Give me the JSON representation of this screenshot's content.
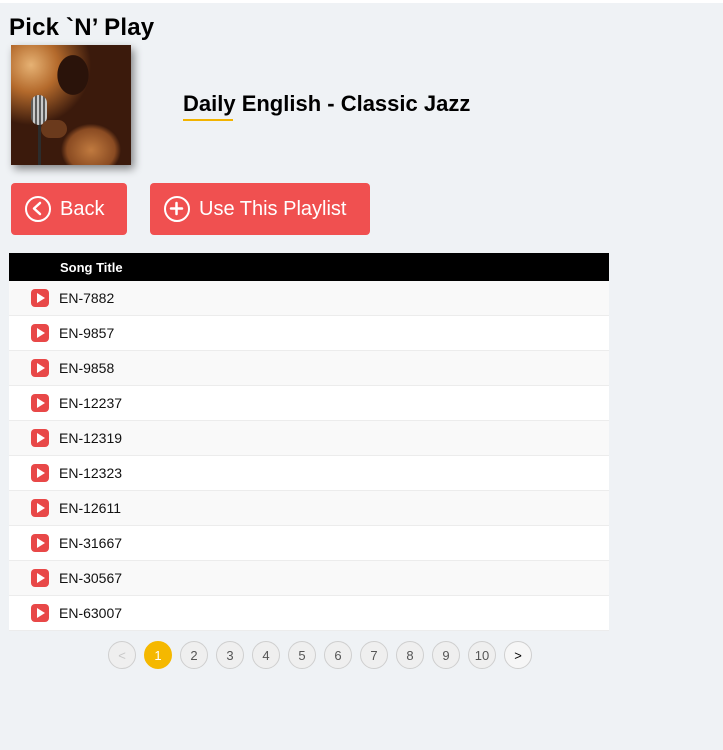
{
  "app": {
    "title": "Pick `N’ Play"
  },
  "playlist": {
    "title": "Daily English - Classic Jazz"
  },
  "buttons": {
    "back": "Back",
    "use": "Use This Playlist"
  },
  "table": {
    "header": "Song Title",
    "rows": [
      "EN-7882",
      "EN-9857",
      "EN-9858",
      "EN-12237",
      "EN-12319",
      "EN-12323",
      "EN-12611",
      "EN-31667",
      "EN-30567",
      "EN-63007"
    ]
  },
  "pagination": {
    "prev": "<",
    "pages": [
      "1",
      "2",
      "3",
      "4",
      "5",
      "6",
      "7",
      "8",
      "9",
      "10"
    ],
    "next": ">",
    "current": "1"
  },
  "colors": {
    "accent": "#f05050",
    "active_page": "#f5b800",
    "underline": "#f2b300"
  },
  "icons": {
    "back": "chevron-left-circle-icon",
    "use": "plus-circle-icon",
    "play": "play-icon"
  }
}
